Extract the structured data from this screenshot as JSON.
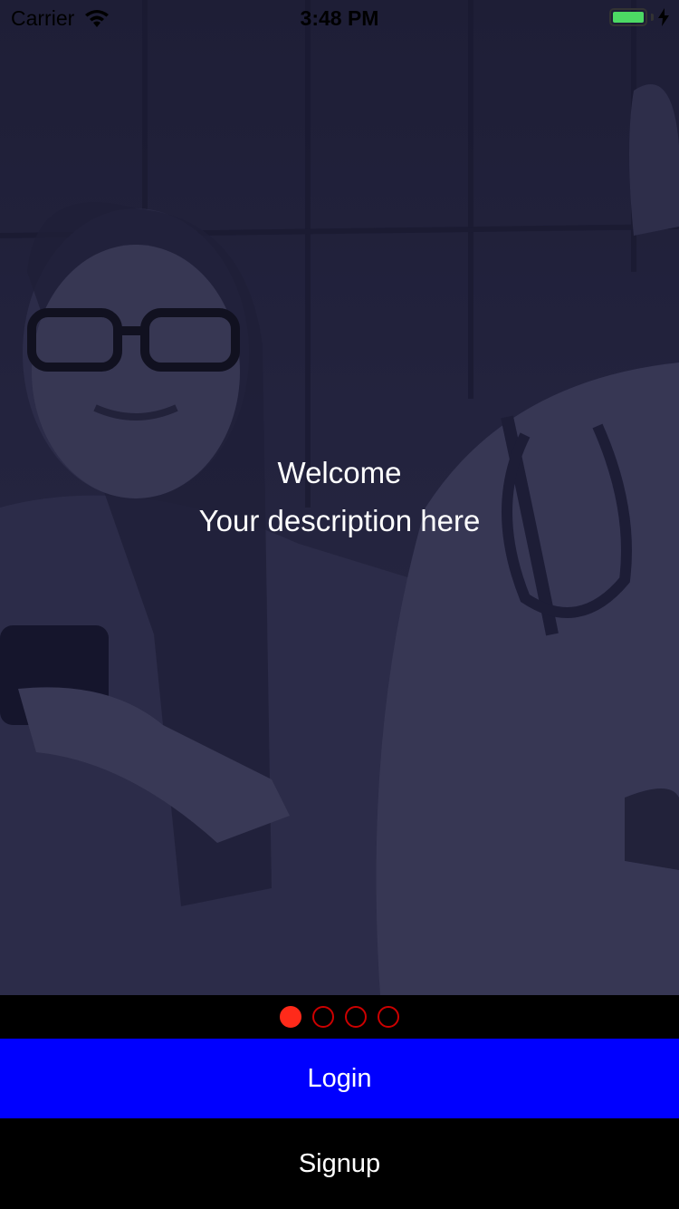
{
  "status_bar": {
    "carrier": "Carrier",
    "time": "3:48 PM",
    "wifi_icon": "wifi-icon",
    "battery_icon": "battery-icon",
    "charging_icon": "bolt-icon",
    "battery_color": "#4cd964"
  },
  "hero": {
    "title": "Welcome",
    "description": "Your description here"
  },
  "pager": {
    "page_count": 4,
    "active_index": 0,
    "active_color": "#ff2a1a",
    "inactive_color": "#cc0000"
  },
  "actions": {
    "login_label": "Login",
    "login_color": "#0000ff",
    "signup_label": "Signup"
  }
}
